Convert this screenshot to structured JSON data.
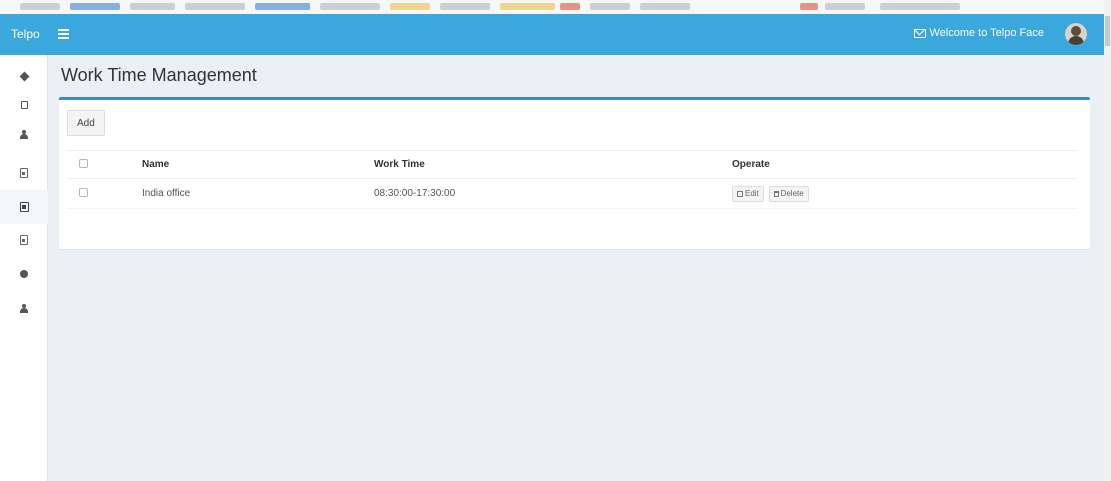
{
  "navbar": {
    "brand": "Telpo",
    "welcome_text": "Welcome to Telpo Face"
  },
  "sidebar": {
    "items": [
      {
        "icon": "dashboard-icon"
      },
      {
        "icon": "device-icon"
      },
      {
        "icon": "user-icon"
      },
      {
        "icon": "document-icon"
      },
      {
        "icon": "work-time-icon",
        "active": true
      },
      {
        "icon": "report-icon"
      },
      {
        "icon": "gear-icon"
      },
      {
        "icon": "admin-user-icon"
      }
    ]
  },
  "page": {
    "title": "Work Time Management"
  },
  "toolbar": {
    "add_label": "Add"
  },
  "table": {
    "headers": {
      "name": "Name",
      "work_time": "Work Time",
      "operate": "Operate"
    },
    "rows": [
      {
        "name": "India office",
        "work_time": "08:30:00-17:30:00",
        "edit_label": "Edit",
        "delete_label": "Delete"
      }
    ]
  },
  "colors": {
    "navbar": "#3aa7dd",
    "panel_accent": "#3c8dbc",
    "background": "#ecf0f5"
  }
}
